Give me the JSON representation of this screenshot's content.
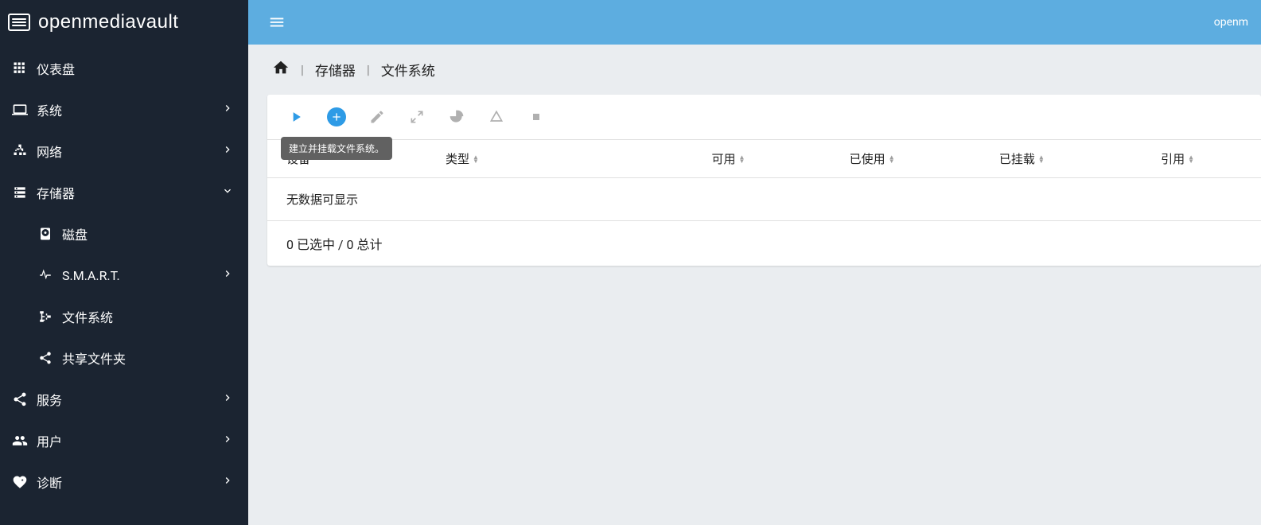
{
  "brand": "openmediavault",
  "topbar": {
    "user": "openm"
  },
  "sidebar": {
    "items": [
      {
        "id": "dashboard",
        "label": "仪表盘",
        "icon": "grid"
      },
      {
        "id": "system",
        "label": "系统",
        "icon": "laptop",
        "chevron": "right"
      },
      {
        "id": "network",
        "label": "网络",
        "icon": "network",
        "chevron": "right"
      },
      {
        "id": "storage",
        "label": "存储器",
        "icon": "storage",
        "chevron": "down"
      },
      {
        "id": "disks",
        "label": "磁盘",
        "icon": "hdd",
        "sub": true
      },
      {
        "id": "smart",
        "label": "S.M.A.R.T.",
        "icon": "pulse",
        "sub": true,
        "chevron": "right"
      },
      {
        "id": "filesystems",
        "label": "文件系统",
        "icon": "tree",
        "sub": true
      },
      {
        "id": "shared",
        "label": "共享文件夹",
        "icon": "share",
        "sub": true
      },
      {
        "id": "services",
        "label": "服务",
        "icon": "share",
        "chevron": "right"
      },
      {
        "id": "users",
        "label": "用户",
        "icon": "users",
        "chevron": "right"
      },
      {
        "id": "diagnostics",
        "label": "诊断",
        "icon": "heart",
        "chevron": "right"
      }
    ]
  },
  "breadcrumb": {
    "home": "home",
    "path": [
      "存储器",
      "文件系统"
    ]
  },
  "toolbar": {
    "tooltip": "建立并挂载文件系统。"
  },
  "table": {
    "columns": [
      "设备",
      "类型",
      "可用",
      "已使用",
      "已挂载",
      "引用"
    ],
    "empty": "无数据可显示",
    "footer": "0 已选中 / 0 总计"
  }
}
